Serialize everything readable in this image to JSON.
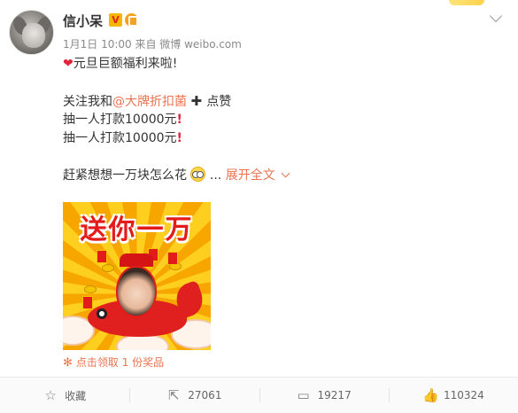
{
  "user": {
    "name": "信小呆",
    "verified_badge": "V",
    "meta": "1月1日 10:00 来自 微博 weibo.com"
  },
  "post": {
    "line1": "元旦巨额福利来啦!",
    "line2_prefix": "关注我和",
    "mention": "@大牌折扣菌",
    "line2_suffix": "点赞",
    "line3": "抽一人打款10000元",
    "line4": "抽一人打款10000元",
    "line5": "赶紧想想一万块怎么花",
    "ellipsis": "...",
    "expand_label": "展开全文"
  },
  "poster": {
    "title": "送你一万"
  },
  "lottery": {
    "label": "点击领取 1 份奖品"
  },
  "actions": [
    {
      "label": "收藏",
      "icon": "star-icon"
    },
    {
      "label": "27061",
      "icon": "repost-icon"
    },
    {
      "label": "19217",
      "icon": "comment-icon"
    },
    {
      "label": "110324",
      "icon": "like-icon"
    }
  ],
  "colors": {
    "accent": "#eb7350",
    "heart": "#e0233c",
    "poster_red": "#e41b1b",
    "poster_yellow": "#ffcf1f"
  }
}
